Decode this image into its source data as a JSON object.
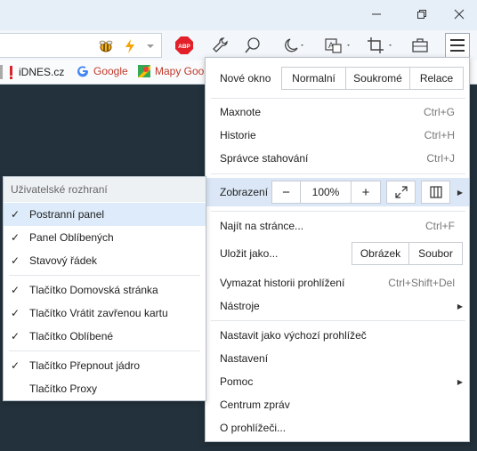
{
  "window": {
    "minimize_icon": "minimize-icon",
    "restore_icon": "restore-icon",
    "close_icon": "close-icon"
  },
  "toolbar": {
    "icons": [
      "bee-icon",
      "lightning-icon",
      "dropdown-icon",
      "adblock-icon",
      "wrench-icon",
      "pen-icon",
      "moon-icon",
      "translate-icon",
      "crop-icon",
      "briefcase-icon",
      "hamburger-icon"
    ],
    "adblock_label": "ABP"
  },
  "bookmarks": [
    {
      "label": "iDNES.cz",
      "icon": "idnes-favicon"
    },
    {
      "label": "Google",
      "icon": "google-favicon"
    },
    {
      "label": "Mapy Goo",
      "icon": "maps-favicon"
    }
  ],
  "menu": {
    "new_window": "Nové okno",
    "new_window_options": [
      "Normalní",
      "Soukromé",
      "Relace"
    ],
    "maxnote": "Maxnote",
    "maxnote_sc": "Ctrl+G",
    "history": "Historie",
    "history_sc": "Ctrl+H",
    "downloads": "Správce stahování",
    "downloads_sc": "Ctrl+J",
    "zoom": "Zobrazení",
    "zoom_minus": "−",
    "zoom_value": "100%",
    "zoom_plus": "+",
    "find": "Najít na stránce...",
    "find_sc": "Ctrl+F",
    "save_as": "Uložit jako...",
    "save_options": [
      "Obrázek",
      "Soubor"
    ],
    "clear_history": "Vymazat historii prohlížení",
    "clear_history_sc": "Ctrl+Shift+Del",
    "tools": "Nástroje",
    "set_default": "Nastavit jako výchozí prohlížeč",
    "settings": "Nastavení",
    "help": "Pomoc",
    "message_center": "Centrum zpráv",
    "about": "O prohlížeči..."
  },
  "submenu": {
    "header": "Uživatelské rozhraní",
    "check": "✓",
    "items": [
      {
        "label": "Postranní panel",
        "checked": true
      },
      {
        "label": "Panel Oblíbených",
        "checked": true
      },
      {
        "label": "Stavový řádek",
        "checked": true
      },
      {
        "label": "Tlačítko Domovská stránka",
        "checked": true
      },
      {
        "label": "Tlačítko Vrátit zavřenou kartu",
        "checked": true
      },
      {
        "label": "Tlačítko Oblíbené",
        "checked": true
      },
      {
        "label": "Tlačítko Přepnout jádro",
        "checked": true
      },
      {
        "label": "Tlačítko Proxy",
        "checked": false
      }
    ]
  }
}
